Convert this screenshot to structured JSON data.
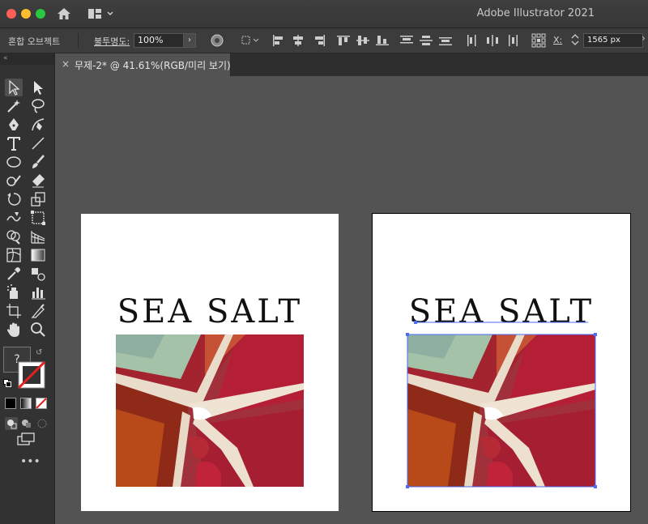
{
  "window": {
    "title": "Adobe Illustrator 2021"
  },
  "control_bar": {
    "selection_type": "혼합 오브젝트",
    "opacity_label": "불투명도:",
    "opacity_value": "100%",
    "x_label": "X:",
    "x_value": "1565 px"
  },
  "document_tab": {
    "label": "무제-2* @ 41.61%(RGB/미리 보기)",
    "close": "×"
  },
  "toolbar": {
    "unknown_label": "?",
    "more": "•••",
    "collapse": "«"
  },
  "artboards": [
    {
      "headline": "SEA SALT"
    },
    {
      "headline": "SEA SALT"
    }
  ],
  "colors": {
    "selection": "#4a6cf7",
    "accent_red": "#e22222"
  }
}
